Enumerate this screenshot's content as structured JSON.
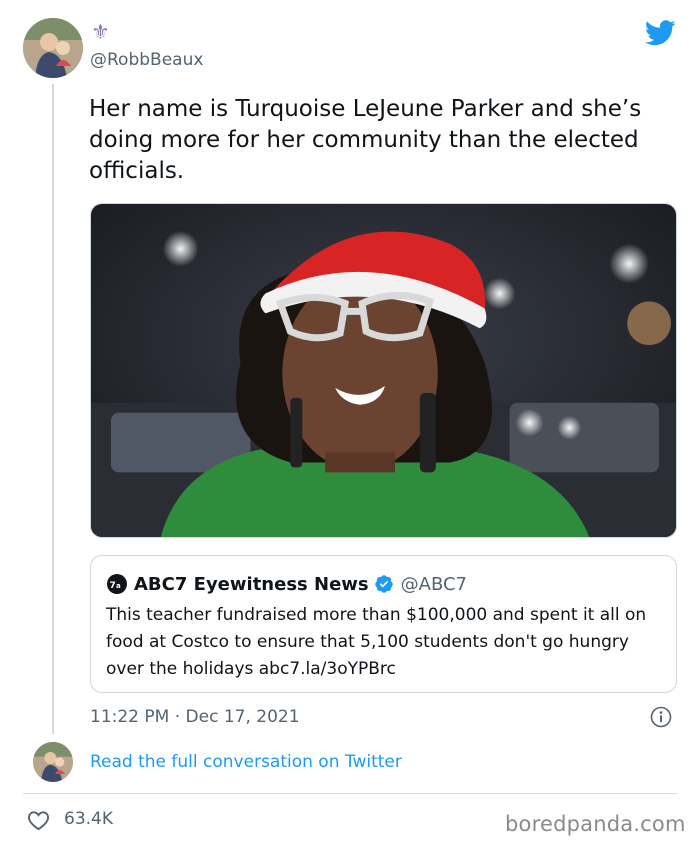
{
  "author": {
    "handle": "@RobbBeaux",
    "name_glyph": "⚜"
  },
  "tweet": {
    "text": "Her name is Turquoise LeJeune Parker and she’s doing more for her community than the elected officials.",
    "timestamp": "11:22 PM · Dec 17, 2021"
  },
  "quoted_tweet": {
    "name": "ABC7 Eyewitness News",
    "handle": "@ABC7",
    "text": "This teacher fundraised more than $100,000 and spent it all on food at Costco to ensure that 5,100 students don't go hungry over the holidays abc7.la/3oYPBrc"
  },
  "footer": {
    "read_link": "Read the full conversation on Twitter",
    "likes": "63.4K",
    "watermark": "boredpanda.com"
  },
  "icons": {
    "brand": "twitter-bird-icon",
    "verified": "verified-badge-icon",
    "info": "info-icon",
    "like": "heart-icon"
  },
  "colors": {
    "twitter_blue": "#1d9bf0",
    "text_primary": "#0f1419",
    "text_secondary": "#536471",
    "border": "#cfd9de"
  }
}
